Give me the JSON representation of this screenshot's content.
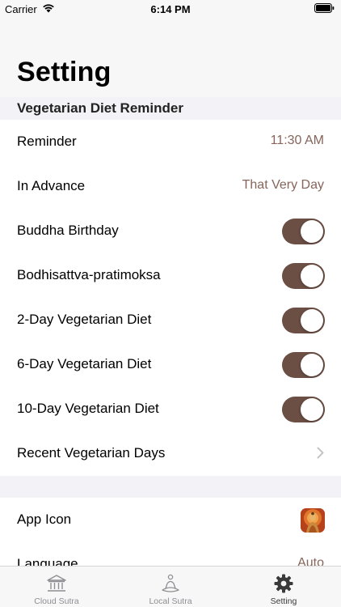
{
  "status_bar": {
    "carrier": "Carrier",
    "time": "6:14 PM"
  },
  "page_title": "Setting",
  "section_header": "Vegetarian Diet Reminder",
  "reminder_rows": [
    {
      "label": "Reminder",
      "value": "11:30 AM"
    },
    {
      "label": "In Advance",
      "value": "That Very Day"
    }
  ],
  "toggle_rows": [
    {
      "label": "Buddha Birthday",
      "on": true
    },
    {
      "label": "Bodhisattva-pratimoksa",
      "on": true
    },
    {
      "label": "2-Day Vegetarian Diet",
      "on": true
    },
    {
      "label": "6-Day Vegetarian Diet",
      "on": true
    },
    {
      "label": "10-Day Vegetarian Diet",
      "on": true
    }
  ],
  "recent_row": {
    "label": "Recent Vegetarian Days"
  },
  "app_rows": [
    {
      "label": "App Icon"
    },
    {
      "label": "Language",
      "value": "Auto"
    }
  ],
  "tabs": [
    {
      "label": "Cloud Sutra",
      "icon": "temple-icon",
      "active": false
    },
    {
      "label": "Local Sutra",
      "icon": "meditation-icon",
      "active": false
    },
    {
      "label": "Setting",
      "icon": "gear-icon",
      "active": true
    }
  ],
  "colors": {
    "accent": "#6b4e44",
    "value_text": "#86655a",
    "background": "#f2f2f7"
  }
}
